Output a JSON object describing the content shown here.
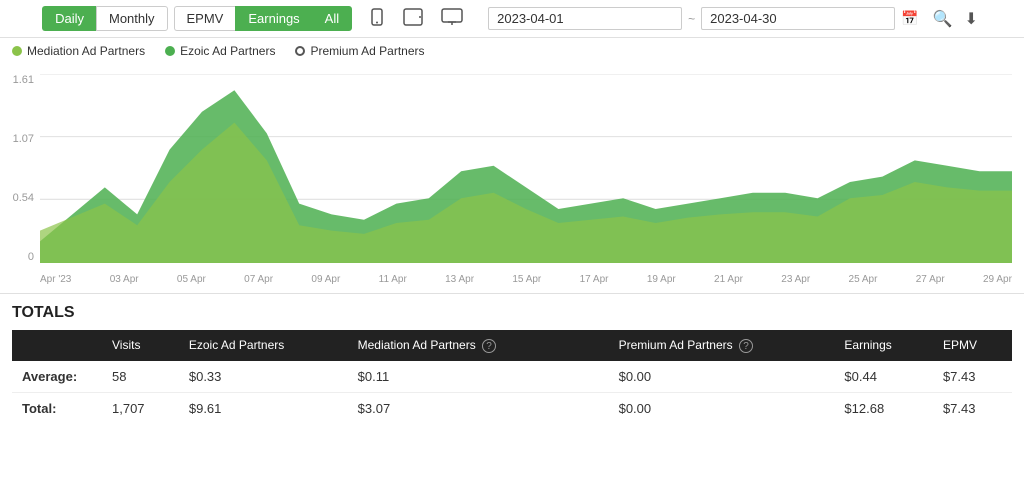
{
  "toolbar": {
    "daily_label": "Daily",
    "monthly_label": "Monthly",
    "epmv_label": "EPMV",
    "earnings_label": "Earnings",
    "all_label": "All",
    "date_start": "2023-04-01",
    "date_end": "2023-04-30",
    "date_separator": "~"
  },
  "legend": {
    "mediation_label": "Mediation Ad Partners",
    "ezoic_label": "Ezoic Ad Partners",
    "premium_label": "Premium Ad Partners"
  },
  "chart": {
    "y_labels": [
      "1.61",
      "1.07",
      "0.54",
      "0"
    ],
    "x_labels": [
      "Apr '23",
      "03 Apr",
      "05 Apr",
      "07 Apr",
      "09 Apr",
      "11 Apr",
      "13 Apr",
      "15 Apr",
      "17 Apr",
      "19 Apr",
      "21 Apr",
      "23 Apr",
      "25 Apr",
      "27 Apr",
      "29 Apr"
    ]
  },
  "totals": {
    "title": "TOTALS",
    "columns": [
      "",
      "Visits",
      "Ezoic Ad Partners",
      "Mediation Ad Partners",
      "Premium Ad Partners",
      "Earnings",
      "EPMV"
    ],
    "rows": [
      {
        "label": "Average:",
        "visits": "58",
        "ezoic": "$0.33",
        "mediation": "$0.11",
        "premium": "$0.00",
        "earnings": "$0.44",
        "epmv": "$7.43"
      },
      {
        "label": "Total:",
        "visits": "1,707",
        "ezoic": "$9.61",
        "mediation": "$3.07",
        "premium": "$0.00",
        "earnings": "$12.68",
        "epmv": "$7.43"
      }
    ]
  }
}
